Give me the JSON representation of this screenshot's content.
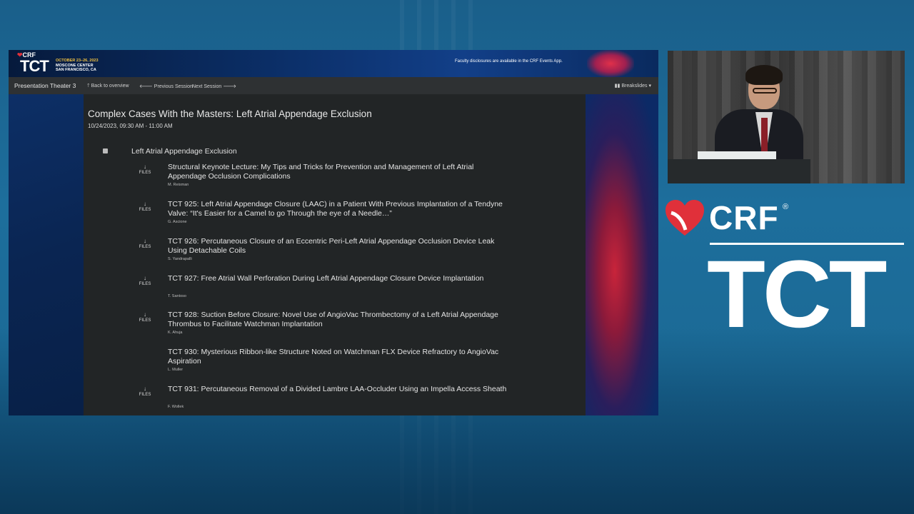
{
  "banner": {
    "crf_label": "CRF",
    "tct_label": "TCT",
    "event_dates": "OCTOBER 23–26, 2023",
    "event_venue": "MOSCONE CENTER",
    "event_city": "SAN FRANCISCO, CA",
    "disclosure": "Faculty disclosures are available in the CRF Events App."
  },
  "navbar": {
    "room": "Presentation Theater 3",
    "back": "Back to overview",
    "previous": "Previous Session",
    "next": "Next Session",
    "breakslides": "Breakslides"
  },
  "session": {
    "title": "Complex Cases With the Masters: Left Atrial Appendage Exclusion",
    "datetime": "10/24/2023, 09:30 AM - 11:00 AM",
    "track": "Left Atrial Appendage Exclusion"
  },
  "files_label": "FILES",
  "talks": [
    {
      "title": "Structural Keynote Lecture: My Tips and Tricks for Prevention and Management of Left Atrial Appendage Occlusion Complications",
      "author": "M. Reisman",
      "has_files": true
    },
    {
      "title": "TCT 925: Left Atrial Appendage Closure (LAAC) in a Patient With Previous Implantation of a Tendyne Valve: “It's Easier for a Camel to go Through the eye of a Needle…”",
      "author": "G. Ascione",
      "has_files": true
    },
    {
      "title": "TCT 926: Percutaneous Closure of an Eccentric Peri-Left Atrial Appendage Occlusion Device Leak Using Detachable Coils",
      "author": "S. Yandrapalli",
      "has_files": true
    },
    {
      "title": "TCT 927: Free Atrial Wall Perforation During Left Atrial Appendage Closure Device Implantation",
      "author": "T. Santoso",
      "has_files": true
    },
    {
      "title": "TCT 928: Suction Before Closure: Novel Use of AngioVac Thrombectomy of a Left Atrial Appendage Thrombus to Facilitate Watchman Implantation",
      "author": "K. Ahuja",
      "has_files": true
    },
    {
      "title": "TCT 930: Mysterious Ribbon-like Structure Noted on Watchman FLX Device Refractory to AngioVac Aspiration",
      "author": "L. Muller",
      "has_files": false
    },
    {
      "title": "TCT 931: Percutaneous Removal of a Divided Lambre LAA-Occluder Using an Impella Access Sheath",
      "author": "F. Wollek",
      "has_files": true
    }
  ],
  "branding": {
    "crf": "CRF",
    "registered": "®",
    "tct": "TCT"
  },
  "colors": {
    "brand_red": "#e0303a",
    "stage_blue": "#1d6e9c",
    "panel_dark": "#222526",
    "navbar_gray": "#2e3133"
  }
}
